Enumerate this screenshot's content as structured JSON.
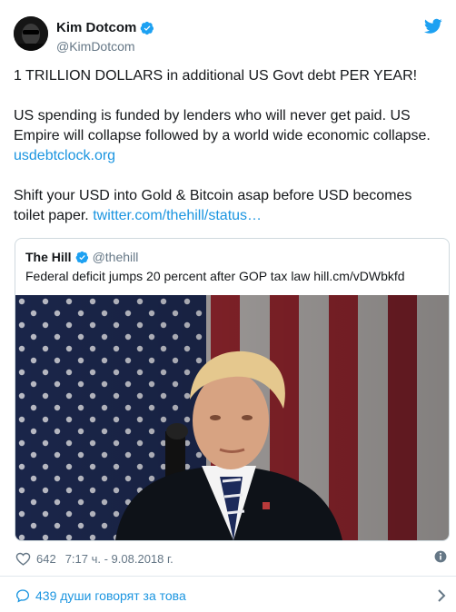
{
  "author": {
    "display_name": "Kim Dotcom",
    "handle": "@KimDotcom"
  },
  "tweet": {
    "paragraphs": [
      {
        "text": "1 TRILLION DOLLARS in additional US Govt debt PER YEAR!",
        "link": ""
      },
      {
        "text": "US spending is funded by lenders who will never get paid. US Empire will collapse followed by a world wide economic collapse.",
        "link": "usdebtclock.org"
      },
      {
        "text": "Shift your USD into Gold & Bitcoin asap before USD becomes toilet paper.",
        "link": "twitter.com/thehill/status…"
      }
    ]
  },
  "quoted_tweet": {
    "display_name": "The Hill",
    "handle": "@thehill",
    "text": "Federal deficit jumps 20 percent after GOP tax law hill.cm/vDWbkfd"
  },
  "meta": {
    "likes": "642",
    "time": "7:17 ч. - 9.08.2018 г."
  },
  "footer": {
    "conversation": "439 души говорят за това"
  },
  "colors": {
    "link": "#1b95e0",
    "verified": "#1da1f2",
    "muted": "#657786",
    "border": "#cfd9de"
  },
  "icons": [
    "verified-badge-icon",
    "twitter-bird-icon",
    "heart-icon",
    "info-icon",
    "reply-bubble-icon",
    "chevron-right-icon"
  ]
}
